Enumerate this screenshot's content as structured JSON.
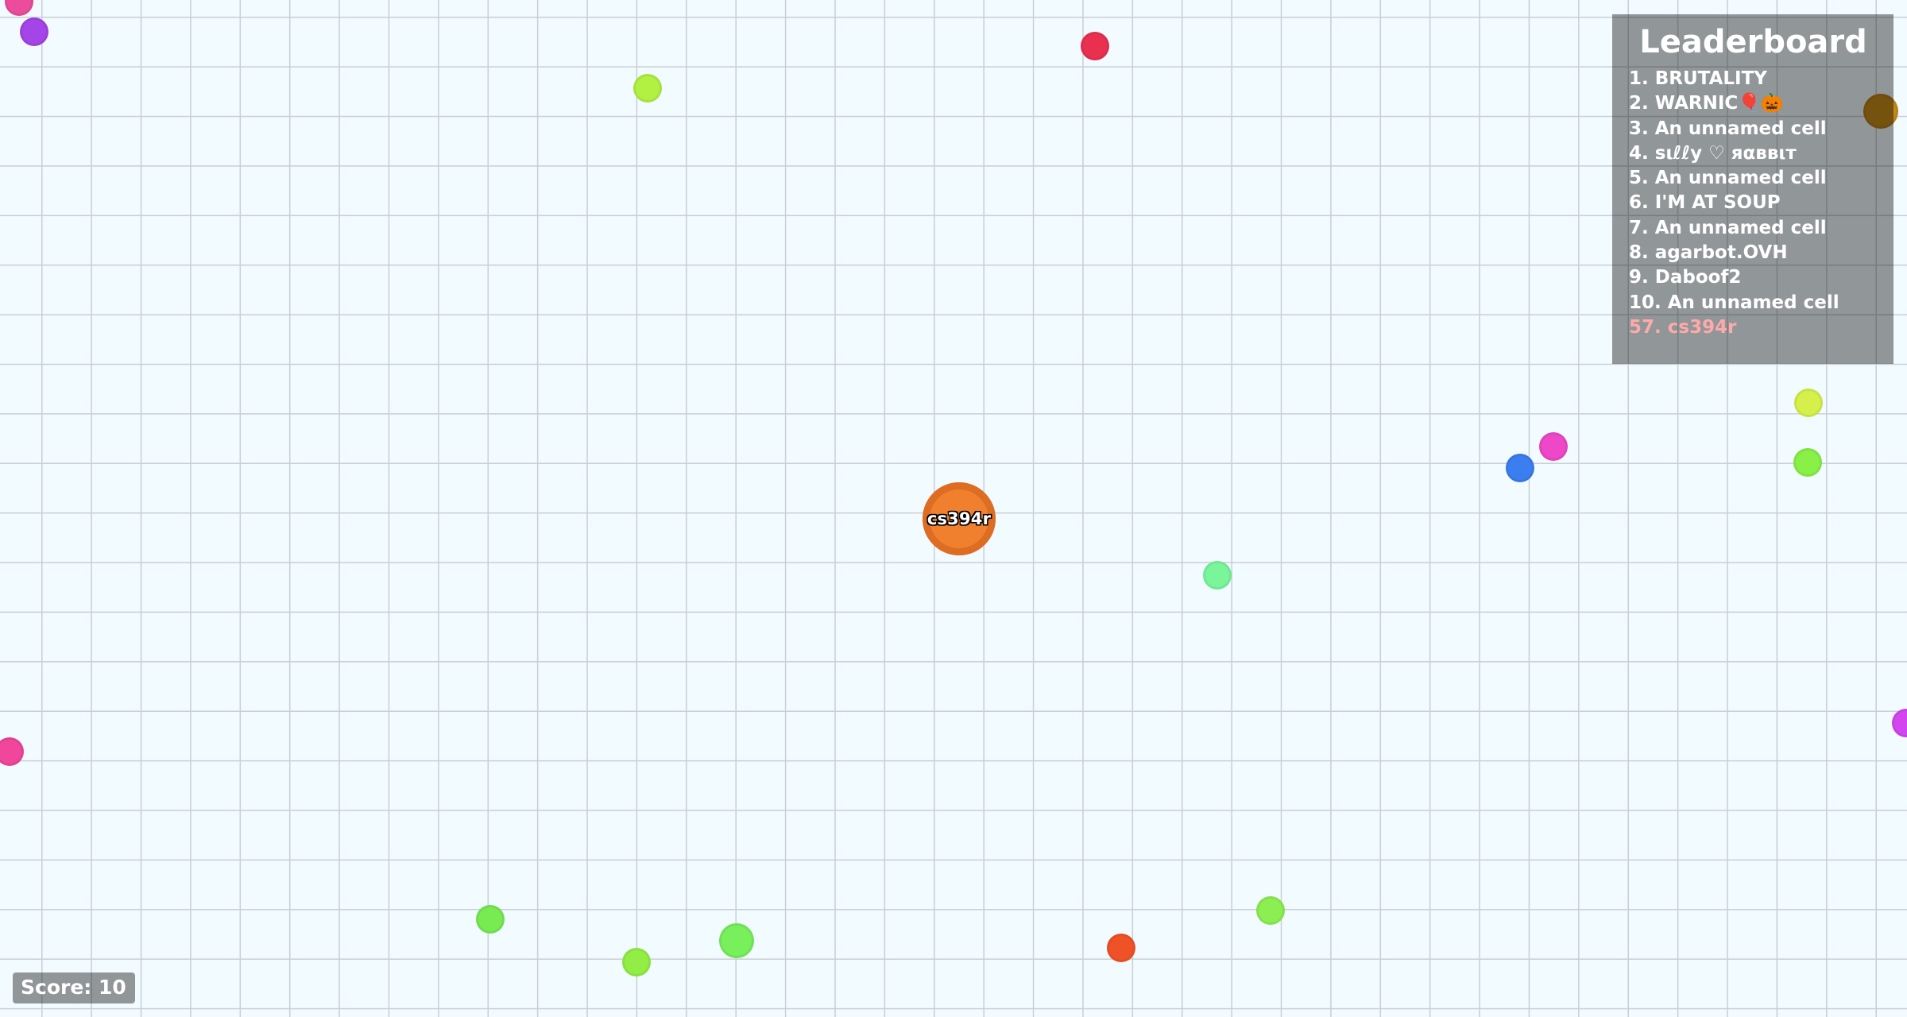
{
  "leaderboard": {
    "title": "Leaderboard",
    "entries": [
      "1. BRUTALITY",
      "2. WARNIC🎈🎃",
      "3. An unnamed cell",
      "4. ѕιℓℓу ♡ яαввιт",
      "5. An unnamed cell",
      "6. I'M AT SOUP",
      "7. An unnamed cell",
      "8. agarbot.OVH",
      "9. Daboof2",
      "10. An unnamed cell"
    ],
    "self_entry": "57. cs394r",
    "self_color": "#ffaaaa"
  },
  "player": {
    "name": "cs394r",
    "color": "#f0802d",
    "border_color": "#dd6d22"
  },
  "score": {
    "label": "Score: 10"
  },
  "pellet_colors": [
    "#ec4c9c",
    "#a445e8",
    "#b2f042",
    "#e93051",
    "#c48a1a",
    "#d5f04a",
    "#ee47c8",
    "#3b7ef0",
    "#88f046",
    "#7af59a",
    "#f0469c",
    "#d246f0",
    "#78ea52",
    "#92ee44",
    "#78f05c",
    "#8cee52",
    "#f05228"
  ],
  "background": {
    "color": "#f2fbff",
    "grid_color": "#c9cfd3"
  }
}
